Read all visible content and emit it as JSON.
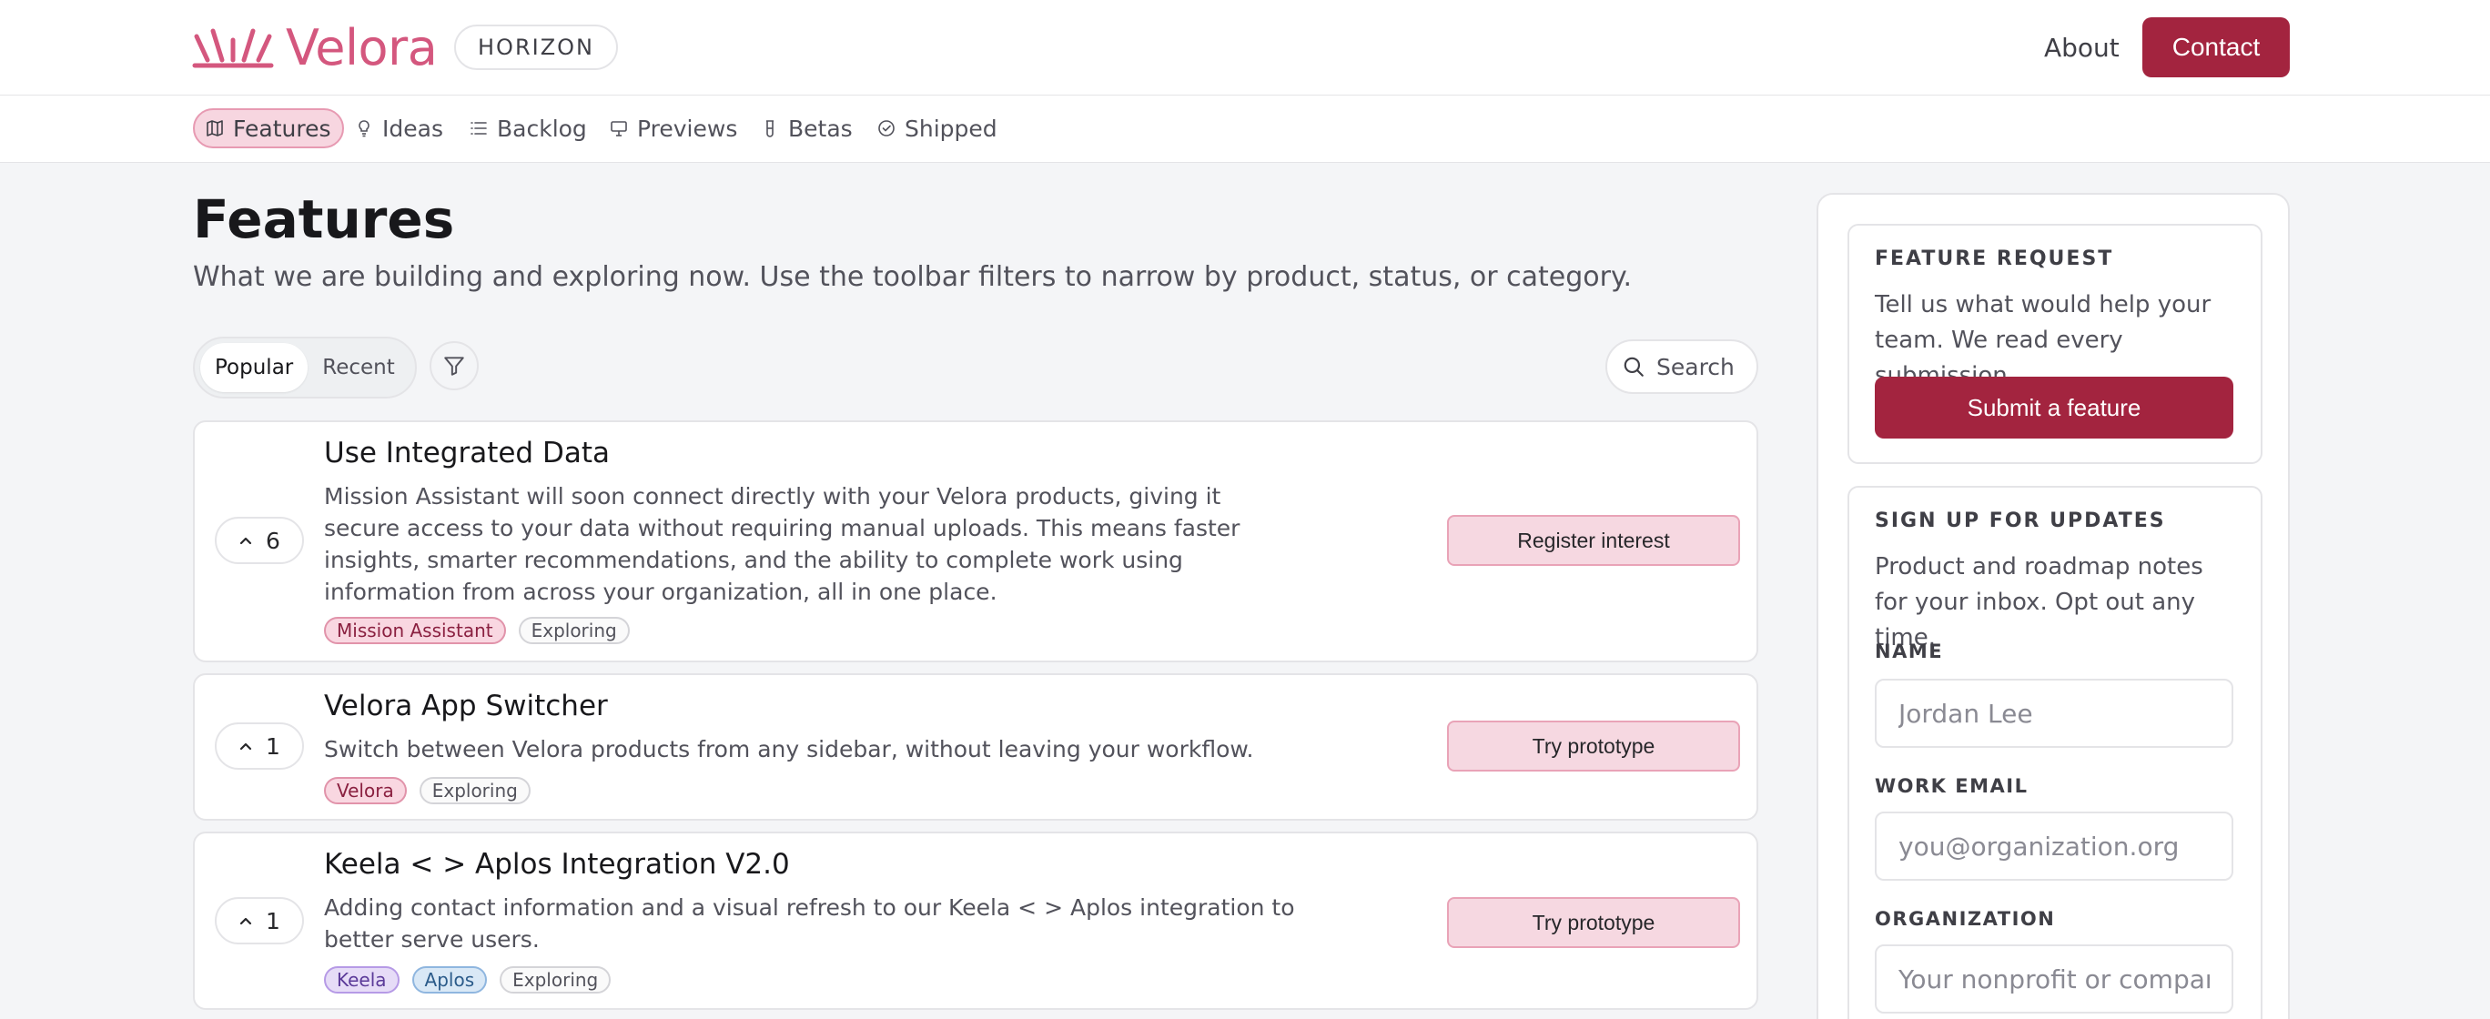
{
  "header": {
    "logo_text": "Velora",
    "badge": "HORIZON",
    "about_label": "About",
    "contact_label": "Contact"
  },
  "subnav": {
    "items": [
      {
        "label": "Features",
        "icon": "map-icon",
        "active": true
      },
      {
        "label": "Ideas",
        "icon": "lightbulb-icon",
        "active": false
      },
      {
        "label": "Backlog",
        "icon": "list-icon",
        "active": false
      },
      {
        "label": "Previews",
        "icon": "presentation-icon",
        "active": false
      },
      {
        "label": "Betas",
        "icon": "flask-icon",
        "active": false
      },
      {
        "label": "Shipped",
        "icon": "check-circle-icon",
        "active": false
      }
    ]
  },
  "main": {
    "title": "Features",
    "subtitle": "What we are building and exploring now. Use the toolbar filters to narrow by product, status, or category.",
    "sort_options": [
      "Popular",
      "Recent"
    ],
    "sort_active": "Popular",
    "search_placeholder": "Search",
    "features": [
      {
        "votes": "6",
        "title": "Use Integrated Data",
        "description": "Mission Assistant will soon connect directly with your Velora products, giving it secure access to your data without requiring manual uploads. This means faster insights, smarter recommendations, and the ability to complete work using information from across your organization, all in one place.",
        "tags": [
          "Mission Assistant",
          "Exploring"
        ],
        "action": "Register interest"
      },
      {
        "votes": "1",
        "title": "Velora App Switcher",
        "description": "Switch between Velora products from any sidebar, without leaving your workflow.",
        "tags": [
          "Velora",
          "Exploring"
        ],
        "action": "Try prototype"
      },
      {
        "votes": "1",
        "title": "Keela < > Aplos Integration V2.0",
        "description": "Adding contact information and a visual refresh to our Keela < > Aplos integration to better serve users.",
        "tags": [
          "Keela",
          "Aplos",
          "Exploring"
        ],
        "action": "Try prototype"
      }
    ]
  },
  "sidebar": {
    "feature_request": {
      "heading": "FEATURE REQUEST",
      "text": "Tell us what would help your team. We read every submission.",
      "button": "Submit a feature"
    },
    "signup": {
      "heading": "SIGN UP FOR UPDATES",
      "text": "Product and roadmap notes for your inbox. Opt out any time.",
      "name_label": "NAME",
      "name_placeholder": "Jordan Lee",
      "email_label": "WORK EMAIL",
      "email_placeholder": "you@organization.org",
      "org_label": "ORGANIZATION",
      "org_placeholder": "Your nonprofit or company"
    }
  },
  "colors": {
    "brand": "#a3243f",
    "logo": "#d4577e",
    "accent_soft": "#f6d8e1"
  }
}
